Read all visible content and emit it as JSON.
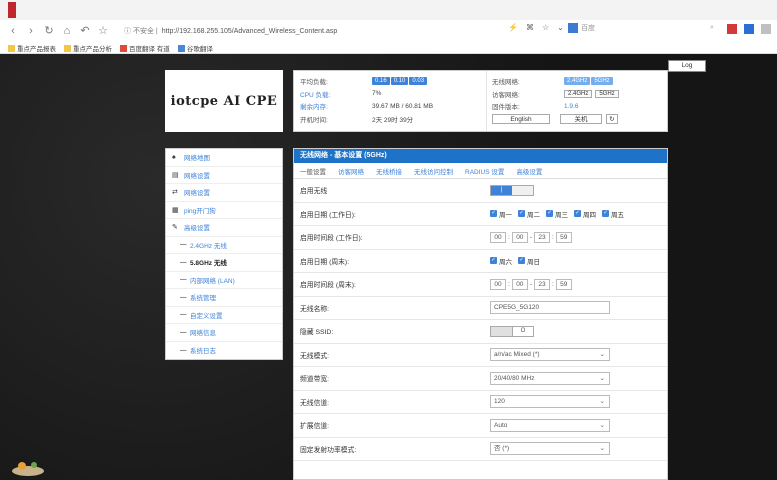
{
  "browser": {
    "secure_label": "不安全",
    "url": "http://192.168.255.105/Advanced_Wireless_Content.asp",
    "search_placeholder": "百度"
  },
  "bookmarks": [
    {
      "label": "重点产品报表"
    },
    {
      "label": "重点产品分析"
    },
    {
      "label": "百度翻译 有道"
    },
    {
      "label": "谷歌翻译"
    }
  ],
  "log_button": "Log",
  "brand": "iotcpe AI CPE",
  "status": {
    "left": [
      {
        "label": "平均负载:",
        "chips": [
          "0.16",
          "0.10",
          "0.03"
        ]
      },
      {
        "label": "CPU 负载:",
        "value": "7%"
      },
      {
        "label": "剩余内存:",
        "value": "39.67 MB / 60.81 MB"
      },
      {
        "label": "开机时间:",
        "value": "2天 29时 39分"
      }
    ],
    "right": [
      {
        "label": "无线网络:",
        "chips": [
          "2.4GHz",
          "5GHz"
        ]
      },
      {
        "label": "访客网络:",
        "buttons": [
          "2.4GHz",
          "5GHz"
        ]
      },
      {
        "label": "固件版本:",
        "value": "1.9.6"
      }
    ],
    "lang_label": "English",
    "shutdown_label": "关机",
    "refresh_label": "↻"
  },
  "sidebar": {
    "items": [
      {
        "icon": "♠",
        "label": "网络地图"
      },
      {
        "icon": "▤",
        "label": "网络设置"
      },
      {
        "icon": "⇄",
        "label": "网络设置"
      },
      {
        "icon": "▦",
        "label": "ping开门狗"
      },
      {
        "icon": "✎",
        "label": "高级设置"
      }
    ],
    "subitems": [
      {
        "label": "2.4GHz 无线",
        "active": false
      },
      {
        "label": "5.8GHz 无线",
        "active": true
      },
      {
        "label": "内部网络 (LAN)",
        "active": false
      },
      {
        "label": "系统管理",
        "active": false
      },
      {
        "label": "自定义设置",
        "active": false
      },
      {
        "label": "网络信息",
        "active": false
      },
      {
        "label": "系统日志",
        "active": false
      }
    ]
  },
  "panel": {
    "title": "无线网络 - 基本设置 (5GHz)",
    "tabs": [
      "一般设置",
      "访客网络",
      "无线桥接",
      "无线访问控制",
      "RADIUS 设置",
      "高级设置"
    ],
    "rows": {
      "enable_label": "启用无线",
      "enable_on": "|",
      "days_label": "启用日期 (工作日):",
      "weekdays": [
        "周一",
        "周二",
        "周三",
        "周四",
        "周五"
      ],
      "time_wd_label": "启用时间段 (工作日):",
      "time_wd": [
        "00",
        "00",
        "23",
        "59"
      ],
      "days_we_label": "启用日期 (周末):",
      "weekend": [
        "周六",
        "周日"
      ],
      "time_we_label": "启用时间段 (周末):",
      "time_we": [
        "00",
        "00",
        "23",
        "59"
      ],
      "ssid_label": "无线名称:",
      "ssid_value": "CPE5G_5G120",
      "hide_label": "隐藏 SSID:",
      "hide_off": "O",
      "mode_label": "无线模式:",
      "mode_value": "a/n/ac Mixed (*)",
      "bw_label": "频道带宽:",
      "bw_value": "20/40/80 MHz",
      "ch_label": "无线信道:",
      "ch_value": "120",
      "ext_label": "扩展信道:",
      "ext_value": "Auto",
      "fix_label": "固定发射功率模式:",
      "fix_value": "否 (*)"
    }
  }
}
